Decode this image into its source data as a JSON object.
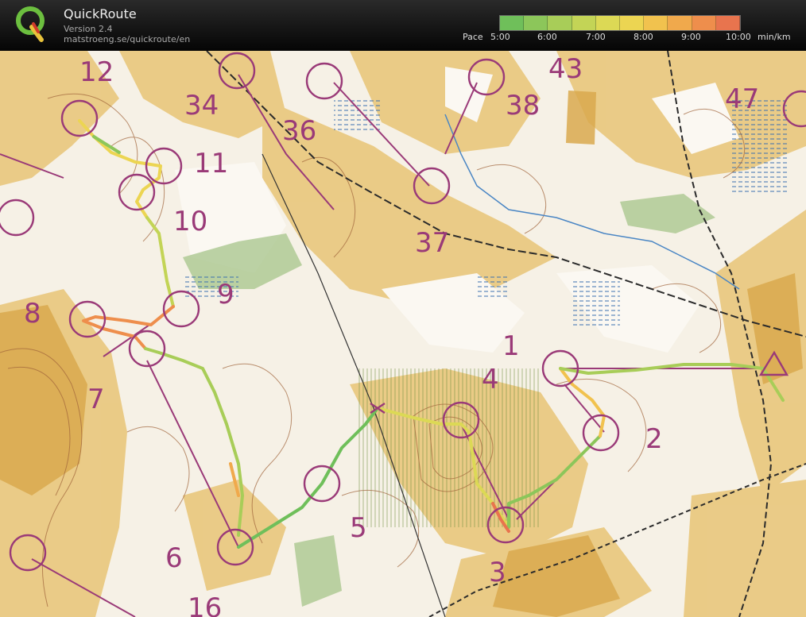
{
  "app": {
    "title": "QuickRoute",
    "version": "Version 2.4",
    "url": "matstroeng.se/quickroute/en"
  },
  "pace_legend": {
    "label": "Pace",
    "ticks": [
      "5:00",
      "6:00",
      "7:00",
      "8:00",
      "9:00",
      "10:00"
    ],
    "unit": "min/km",
    "colors": [
      "#6fbf5a",
      "#8cc65a",
      "#a8cd58",
      "#c3d456",
      "#dcd955",
      "#ecd552",
      "#f1c24e",
      "#f0a94c",
      "#ee8e4c",
      "#e8744e"
    ]
  },
  "map": {
    "controls": [
      {
        "number": "1"
      },
      {
        "number": "2"
      },
      {
        "number": "3"
      },
      {
        "number": "4"
      },
      {
        "number": "5"
      },
      {
        "number": "6"
      },
      {
        "number": "7"
      },
      {
        "number": "8"
      },
      {
        "number": "9"
      },
      {
        "number": "10"
      },
      {
        "number": "11"
      },
      {
        "number": "12"
      },
      {
        "number": "16"
      },
      {
        "number": "34"
      },
      {
        "number": "36"
      },
      {
        "number": "37"
      },
      {
        "number": "38"
      },
      {
        "number": "43"
      },
      {
        "number": "47"
      }
    ],
    "colors": {
      "control": "#9a3a78",
      "terrain_open": "#e8c77a",
      "terrain_forest": "#fbf8f2",
      "contour": "#a0643a",
      "green": "#a6c48a"
    }
  }
}
